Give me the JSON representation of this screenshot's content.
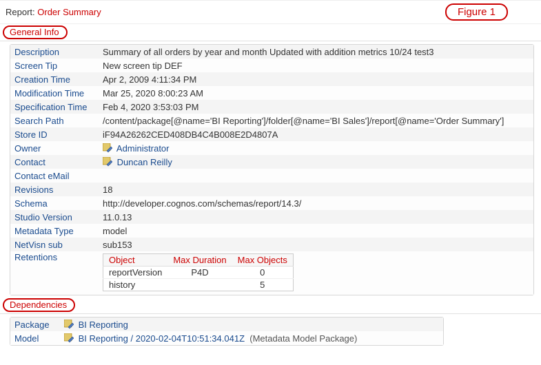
{
  "header": {
    "report_label": "Report:",
    "report_name": "Order Summary",
    "figure_label": "Figure 1"
  },
  "general": {
    "title": "General Info",
    "rows": {
      "description": {
        "label": "Description",
        "value": "Summary of all orders by year and month Updated with addition metrics 10/24 test3"
      },
      "screen_tip": {
        "label": "Screen Tip",
        "value": "New screen tip DEF"
      },
      "creation_time": {
        "label": "Creation Time",
        "value": "Apr 2, 2009 4:11:34 PM"
      },
      "modification_time": {
        "label": "Modification Time",
        "value": "Mar 25, 2020 8:00:23 AM"
      },
      "specification_time": {
        "label": "Specification Time",
        "value": "Feb 4, 2020 3:53:03 PM"
      },
      "search_path": {
        "label": "Search Path",
        "value": "/content/package[@name='BI Reporting']/folder[@name='BI Sales']/report[@name='Order Summary']"
      },
      "store_id": {
        "label": "Store ID",
        "value": "iF94A26262CED408DB4C4B008E2D4807A"
      },
      "owner": {
        "label": "Owner",
        "value": "Administrator"
      },
      "contact": {
        "label": "Contact",
        "value": "Duncan Reilly"
      },
      "contact_email": {
        "label": "Contact eMail",
        "value": ""
      },
      "revisions": {
        "label": "Revisions",
        "value": "18"
      },
      "schema": {
        "label": "Schema",
        "value": "http://developer.cognos.com/schemas/report/14.3/"
      },
      "studio_version": {
        "label": "Studio Version",
        "value": "11.0.13"
      },
      "metadata_type": {
        "label": "Metadata Type",
        "value": "model"
      },
      "netvisn_sub": {
        "label": "NetVisn sub",
        "value": "sub153"
      },
      "retentions": {
        "label": "Retentions"
      }
    },
    "retentions_table": {
      "headers": {
        "object": "Object",
        "max_duration": "Max Duration",
        "max_objects": "Max Objects"
      },
      "rows": [
        {
          "object": "reportVersion",
          "max_duration": "P4D",
          "max_objects": "0"
        },
        {
          "object": "history",
          "max_duration": "",
          "max_objects": "5"
        }
      ]
    }
  },
  "dependencies": {
    "title": "Dependencies",
    "rows": {
      "package": {
        "label": "Package",
        "value": "BI Reporting"
      },
      "model": {
        "label": "Model",
        "value": "BI Reporting / 2020-02-04T10:51:34.041Z",
        "suffix": "(Metadata Model Package)"
      }
    }
  }
}
